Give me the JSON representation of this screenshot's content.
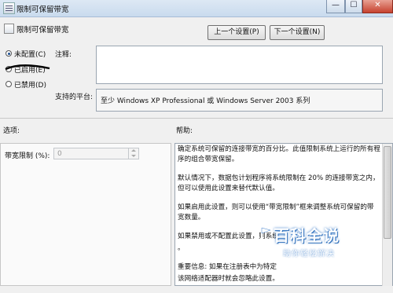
{
  "window": {
    "title": "限制可保留带宽",
    "min_label": "—",
    "max_label": "☐",
    "close_label": "✕"
  },
  "header": {
    "title": "限制可保留带宽",
    "prev_button": "上一个设置(P)",
    "next_button": "下一个设置(N)"
  },
  "state": {
    "options": [
      {
        "label": "未配置(C)",
        "selected": true
      },
      {
        "label": "已启用(E)",
        "selected": false
      },
      {
        "label": "已禁用(D)",
        "selected": false
      }
    ]
  },
  "comment": {
    "label": "注释:",
    "value": ""
  },
  "supported": {
    "label": "支持的平台:",
    "value": "至少 Windows XP Professional 或 Windows Server 2003 系列"
  },
  "options_section": {
    "heading": "选项:",
    "field_label": "带宽限制 (%):",
    "field_value": "0"
  },
  "help_section": {
    "heading": "帮助:",
    "paragraphs": [
      "确定系统可保留的连接带宽的百分比。此值限制系统上运行的所有程序的组合带宽保留。",
      "默认情况下，数据包计划程序将系统限制在 20% 的连接带宽之内，但可以使用此设置来替代默认值。",
      "如果启用此设置，则可以使用“带宽限制”框来调整系统可保留的带宽数量。",
      "如果禁用或不配置此设置，则系统",
      "。",
      "重要信息: 如果在注册表中为特定",
      "该网络适配器时就会忽略此设置。"
    ]
  },
  "watermark": {
    "title": "百科全说",
    "subtitle": "助你轻松解决"
  }
}
